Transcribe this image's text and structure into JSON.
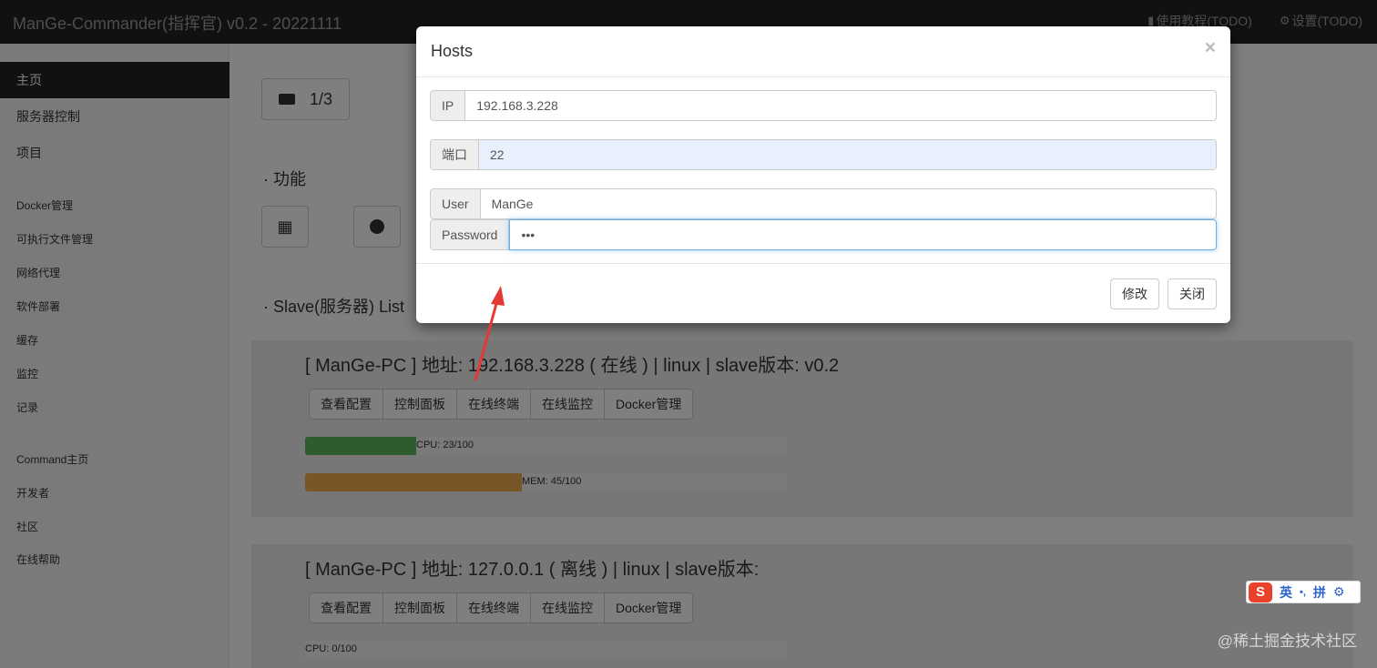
{
  "navbar": {
    "brand": "ManGe-Commander(指挥官) v0.2 - 20221111",
    "tutorial": "使用教程(TODO)",
    "settings": "设置(TODO)"
  },
  "sidebar": {
    "items": [
      {
        "label": "主页",
        "active": true
      },
      {
        "label": "服务器控制"
      },
      {
        "label": "项目"
      },
      {
        "label": "Docker管理"
      },
      {
        "label": "可执行文件管理"
      },
      {
        "label": "网络代理"
      },
      {
        "label": "软件部署"
      },
      {
        "label": "缓存"
      },
      {
        "label": "监控"
      },
      {
        "label": "记录"
      },
      {
        "label": "Command主页"
      },
      {
        "label": "开发者"
      },
      {
        "label": "社区"
      },
      {
        "label": "在线帮助"
      }
    ]
  },
  "main": {
    "server_count": "1/3",
    "functions_title": "· 功能",
    "slave_list_title": "· Slave(服务器) List",
    "hosts": [
      {
        "title": "[ ManGe-PC ] 地址: 192.168.3.228 ( 在线 ) | linux | slave版本: v0.2",
        "actions": [
          "查看配置",
          "控制面板",
          "在线终端",
          "在线监控",
          "Docker管理"
        ],
        "cpu_label": "CPU: 23/100",
        "cpu_value": 23,
        "mem_label": "MEM: 45/100",
        "mem_value": 45
      },
      {
        "title": "[ ManGe-PC ] 地址: 127.0.0.1 ( 离线 ) | linux | slave版本:",
        "actions": [
          "查看配置",
          "控制面板",
          "在线终端",
          "在线监控",
          "Docker管理"
        ],
        "cpu_label": "CPU: 0/100",
        "cpu_value": 0
      }
    ]
  },
  "modal": {
    "title": "Hosts",
    "close": "×",
    "fields": {
      "ip_label": "IP",
      "ip_value": "192.168.3.228",
      "port_label": "端口",
      "port_value": "22",
      "user_label": "User",
      "user_value": "ManGe",
      "password_label": "Password",
      "password_value": "•••"
    },
    "save_label": "修改",
    "close_label": "关闭"
  },
  "ime": {
    "logo": "S",
    "lang": "英",
    "punct": "•,",
    "mode": "拼",
    "settings": "⚙"
  },
  "watermark": "@稀土掘金技术社区",
  "colors": {
    "navbar_bg": "#222222",
    "cpu_bar": "#5cb85c",
    "mem_bar": "#f0ad4e",
    "focus": "#66afe9",
    "arrow": "#e53935"
  }
}
